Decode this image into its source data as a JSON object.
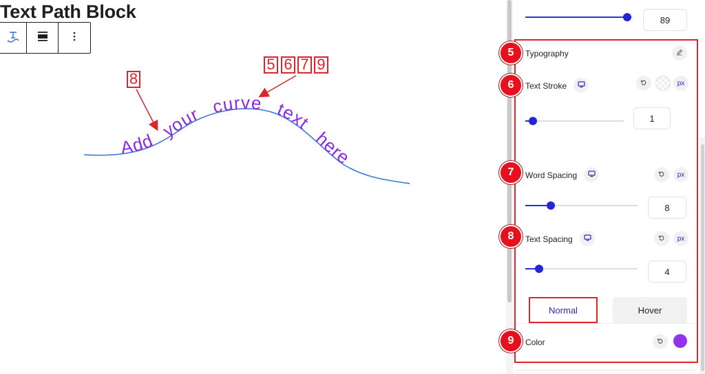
{
  "page": {
    "title": "Text Path Block"
  },
  "toolbar": {
    "buttons": [
      {
        "name": "text-path-icon"
      },
      {
        "name": "align-icon"
      },
      {
        "name": "more-options-icon"
      }
    ]
  },
  "canvas": {
    "curve_text": "Add your curve text here",
    "text_color": "#8a2be2",
    "curve_color": "#3a78d8",
    "annotations": {
      "single": "8",
      "group": [
        "5",
        "6",
        "7",
        "9"
      ]
    }
  },
  "sidebar": {
    "top_slider": {
      "value": "89",
      "fraction": 0.95
    },
    "sections": {
      "typography": {
        "label": "Typography",
        "step": "5"
      },
      "text_stroke": {
        "label": "Text Stroke",
        "step": "6",
        "value": "1",
        "unit": "px",
        "fraction": 0.08
      },
      "word_spacing": {
        "label": "Word Spacing",
        "step": "7",
        "value": "8",
        "unit": "px",
        "fraction": 0.23
      },
      "text_spacing": {
        "label": "Text Spacing",
        "step": "8",
        "value": "4",
        "unit": "px",
        "fraction": 0.12
      }
    },
    "tabs": {
      "normal": "Normal",
      "hover": "Hover"
    },
    "color": {
      "label": "Color",
      "step": "9",
      "value": "#9333ea"
    }
  },
  "colors": {
    "accent": "#2424d9",
    "annotation": "#e0242c"
  }
}
